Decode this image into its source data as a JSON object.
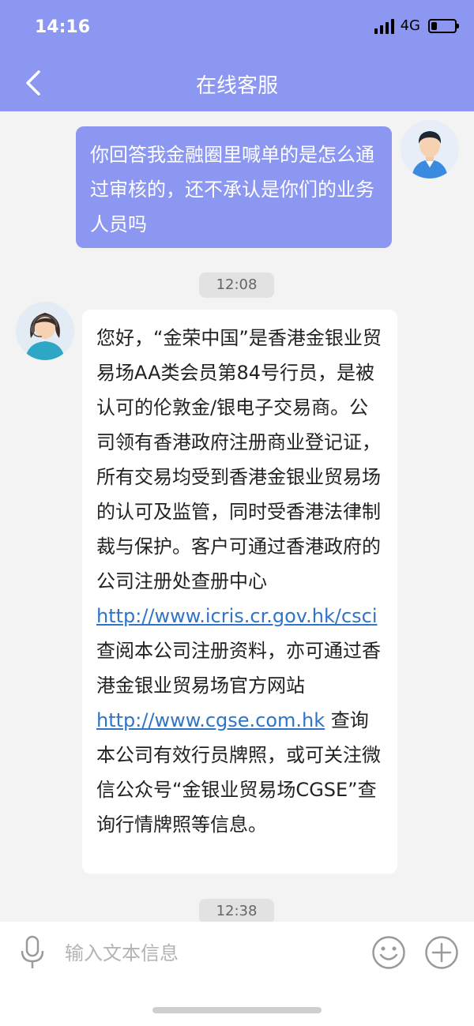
{
  "status_bar": {
    "time": "14:16",
    "network": "4G",
    "signal_bars": 4,
    "battery_level": 0.25
  },
  "header": {
    "title": "在线客服",
    "back_icon": "chevron-left-icon",
    "background_color": "#8c97f1"
  },
  "messages": [
    {
      "sender": "user",
      "text": "你回答我金融圈里喊单的是怎么通过审核的，还不承认是你们的业务人员吗"
    },
    {
      "timestamp": "12:08"
    },
    {
      "sender": "agent",
      "parts": [
        "您好，“金荣中国”是香港金银业贸易场AA类会员第84号行员，是被认可的伦敦金/银电子交易商。公司领有香港政府注册商业登记证，所有交易均受到香港金银业贸易场的认可及监管，同时受香港法律制裁与保护。客户可通过香港政府的公司注册处查册中心",
        "http://www.icris.cr.gov.hk/csci",
        " 查阅本公司注册资料，亦可通过香港金银业贸易场官方网站",
        "http://www.cgse.com.hk",
        " 查询本公司有效行员牌照，或可关注微信公众号“金银业贸易场CGSE”查询行情牌照等信息。"
      ]
    },
    {
      "timestamp": "12:38"
    }
  ],
  "input_bar": {
    "placeholder": "输入文本信息",
    "value": "",
    "icons": [
      "microphone-icon",
      "emoji-icon",
      "plus-icon"
    ]
  },
  "colors": {
    "accent": "#8c97f1",
    "link": "#2f74c8",
    "background": "#f3f3f3"
  }
}
